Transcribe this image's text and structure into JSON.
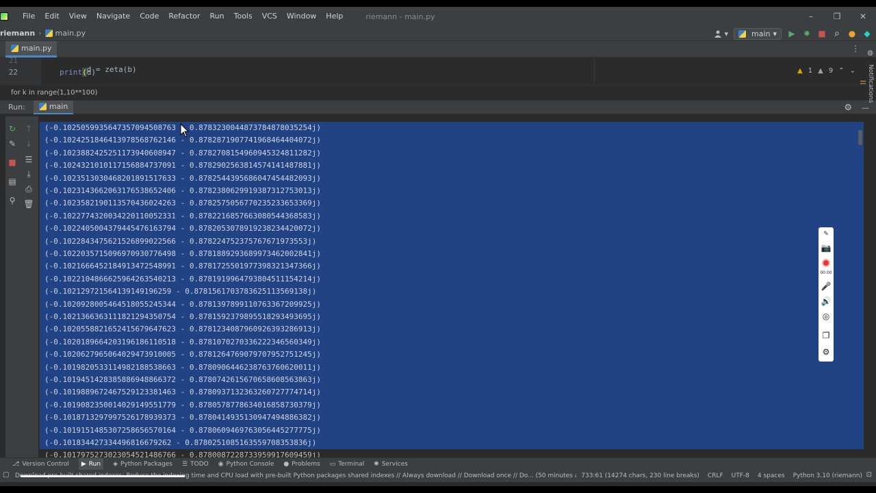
{
  "menubar": {
    "items": [
      "File",
      "Edit",
      "View",
      "Navigate",
      "Code",
      "Refactor",
      "Run",
      "Tools",
      "VCS",
      "Window",
      "Help"
    ],
    "window_title": "riemann - main.py",
    "minimize": "–",
    "maximize": "❐",
    "close": "✕"
  },
  "navbar": {
    "project": "riemann",
    "separator": "›",
    "file": "main.py",
    "run_config": "main",
    "user_icon": "user-icon",
    "run_config_dropdown": "▾",
    "run_button": "▶",
    "debug_button": "✹",
    "stop_button": "■",
    "search_icon": "⌕",
    "update_icon": "●",
    "jetbrains_icon": "◆"
  },
  "tabs": [
    {
      "label": "main.py"
    }
  ],
  "editor": {
    "lines": [
      {
        "number": "21",
        "code_prefix": "d = zeta(b)",
        "code_keyword": "",
        "code_paren": "",
        "code_suffix": ""
      },
      {
        "number": "22",
        "code_prefix": "",
        "code_keyword": "print",
        "code_paren": "(",
        "code_suffix": "d)"
      }
    ],
    "warnings": "1",
    "weak_warnings": "9",
    "up_arrow": "⌃",
    "down_arrow": "⌄",
    "more_icon": "⋮"
  },
  "breadcrumb": "for k in range(1,10**100)",
  "run": {
    "label": "Run:",
    "tab": "main",
    "settings_icon": "⚙",
    "hide_icon": "—"
  },
  "console": {
    "lines": [
      "(-0.10250599356473570945087​63 - 0.87832300448737848780352​54j)",
      "(-0.10242518464139785687621​46 - 0.87828719077419684640407​2j)"
    ],
    "output": [
      "(-0.1025059935647357094508763 - 0.8783230044873784878035254j)",
      "(-0.1024251846413978568762146 - 0.878287190774196846440407​2j)",
      "(-0.1023882425251173940608947 - 0.8782708154960945324811282j)",
      "(-0.1024321010117156884737091 - 0.8782902563814574141487881j)",
      "(-0.1023513030468201891517633 - 0.8782544395686047454482093j)",
      "(-0.1023143662063176538652406 - 0.8782380629919387312753013j)",
      "(-0.1023582190113570436024263 - 0.8782575056770235233653369j)",
      "(-0.1022774320034220110052331 - 0.8782216857663080544368583j)",
      "(-0.1022405004379445476163794 - 0.8782053078919238234420072j)",
      "(-0.1022843475621526899022566 - 0.8782247523757676719735​53j)",
      "(-0.1022035715096970930776498 - 0.8781889293689973462002841j)",
      "(-0.1021666452184913472548991 - 0.8781725501977398321347366j)",
      "(-0.1022104866625964263540213 - 0.8781919964793804511154214j)",
      "(-0.1021297215641391491962​59 - 0.8781561703783625113569138j)",
      "(-0.1020928005464518055245344 - 0.8781397899110763367209925j)",
      "(-0.1021366363111821294350754 - 0.8781592379895518293493695j)",
      "(-0.1020558821652415679647623 - 0.8781234087960926393286913j)",
      "(-0.1020189664203196186110518 - 0.8781070270336222346560349j)",
      "(-0.1020627965064029473910005 - 0.8781264769079707952751245j)",
      "(-0.1019820533114982188538663 - 0.8780906446238763760620011j)",
      "(-0.1019451428385886948866372 - 0.8780742615670658608563863j)",
      "(-0.1019889672467529123381463 - 0.8780937132363260727774714j)",
      "(-0.1019082350014029149551779 - 0.8780578778634016858730379j)",
      "(-0.1018713297997526178939373 - 0.8780414935130947494886382j)",
      "(-0.1019151485307258656570164 - 0.8780609469763056445277775j)",
      "(-0.1018344273344968166792​62 - 0.8780251085163559708353836j)",
      "(-0.1017975273023054521486766 - 0.8780087228733959917609459j)"
    ]
  },
  "recorder": {
    "time": "00:00"
  },
  "sidebar_right": {
    "notifications": "Notifications"
  },
  "bottom_tools": [
    {
      "label": "Version Control",
      "icon": "⎇"
    },
    {
      "label": "Run",
      "icon": "▶"
    },
    {
      "label": "Python Packages",
      "icon": "◈"
    },
    {
      "label": "TODO",
      "icon": "☰"
    },
    {
      "label": "Python Console",
      "icon": "◉"
    },
    {
      "label": "Problems",
      "icon": "●"
    },
    {
      "label": "Terminal",
      "icon": "▭"
    },
    {
      "label": "Services",
      "icon": "✺"
    }
  ],
  "status": {
    "message": "Download pre-built shared indexes: Reduce the indexing time and CPU load with pre-built Python packages shared indexes // Always download // Download once // Do... (50 minutes a",
    "position": "733:61 (14274 chars, 230 line breaks)",
    "line_sep": "CRLF",
    "encoding": "UTF-8",
    "indent": "4 spaces",
    "interpreter": "Python 3.10 (riemann)"
  }
}
